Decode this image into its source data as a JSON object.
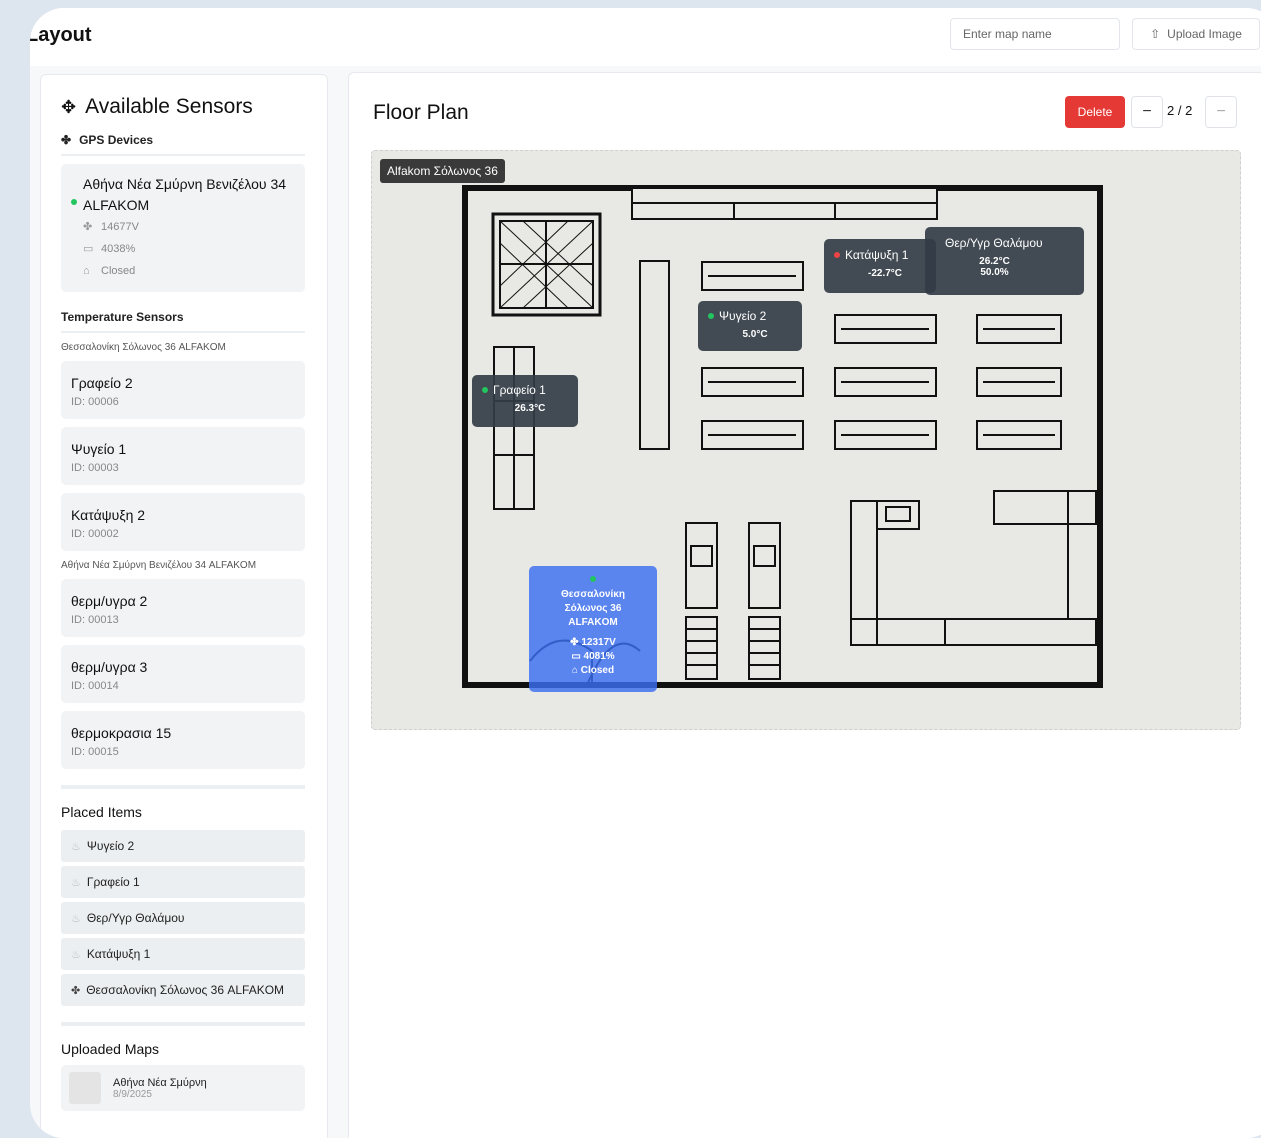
{
  "header": {
    "title": "Layout",
    "map_name_placeholder": "Enter map name",
    "upload_label": "Upload Image"
  },
  "sidebar": {
    "title": "Available Sensors",
    "gps_section": "GPS Devices",
    "gps_device": {
      "name": "Αθήνα Νέα Σμύρνη Βενιζέλου 34 ALFAKOM",
      "voltage": "14677V",
      "battery": "4038%",
      "door": "Closed"
    },
    "temp_section": "Temperature Sensors",
    "groups": [
      {
        "location": "Θεσσαλονίκη Σόλωνος 36 ALFAKOM",
        "sensors": [
          {
            "name": "Γραφείο 2",
            "id": "ID: 00006"
          },
          {
            "name": "Ψυγείο 1",
            "id": "ID: 00003"
          },
          {
            "name": "Κατάψυξη 2",
            "id": "ID: 00002"
          }
        ]
      },
      {
        "location": "Αθήνα Νέα Σμύρνη Βενιζέλου 34 ALFAKOM",
        "sensors": [
          {
            "name": "θερμ/υγρα 2",
            "id": "ID: 00013"
          },
          {
            "name": "θερμ/υγρα 3",
            "id": "ID: 00014"
          },
          {
            "name": "θερμοκρασια 15",
            "id": "ID: 00015"
          }
        ]
      }
    ],
    "placed_title": "Placed Items",
    "placed": [
      "Ψυγείο 2",
      "Γραφείο 1",
      "Θερ/Υγρ Θαλάμου",
      "Κατάψυξη 1",
      "Θεσσαλονίκη Σόλωνος 36 ALFAKOM"
    ],
    "uploaded_title": "Uploaded Maps",
    "uploaded_maps": [
      {
        "name": "Αθήνα Νέα Σμύρνη",
        "date": "8/9/2025"
      }
    ]
  },
  "main": {
    "title": "Floor Plan",
    "delete_label": "Delete",
    "page_indicator": "2 / 2",
    "location_tag": "Alfakom Σόλωνος 36",
    "overlays": {
      "katapsyxi1": {
        "name": "Κατάψυξη 1",
        "temp": "-22.7°C",
        "status_color": "#ef4444"
      },
      "thalamou": {
        "name": "Θερ/Υγρ Θαλάμου",
        "temp": "26.2°C",
        "hum": "50.0%"
      },
      "psygeio2": {
        "name": "Ψυγείο 2",
        "temp": "5.0°C",
        "status_color": "#22c55e"
      },
      "grafeio1": {
        "name": "Γραφείο 1",
        "temp": "26.3°C",
        "status_color": "#22c55e"
      },
      "gps": {
        "name": "Θεσσαλονίκη Σόλωνος 36 ALFAKOM",
        "voltage": "12317V",
        "battery": "4081%",
        "door": "Closed"
      }
    }
  }
}
